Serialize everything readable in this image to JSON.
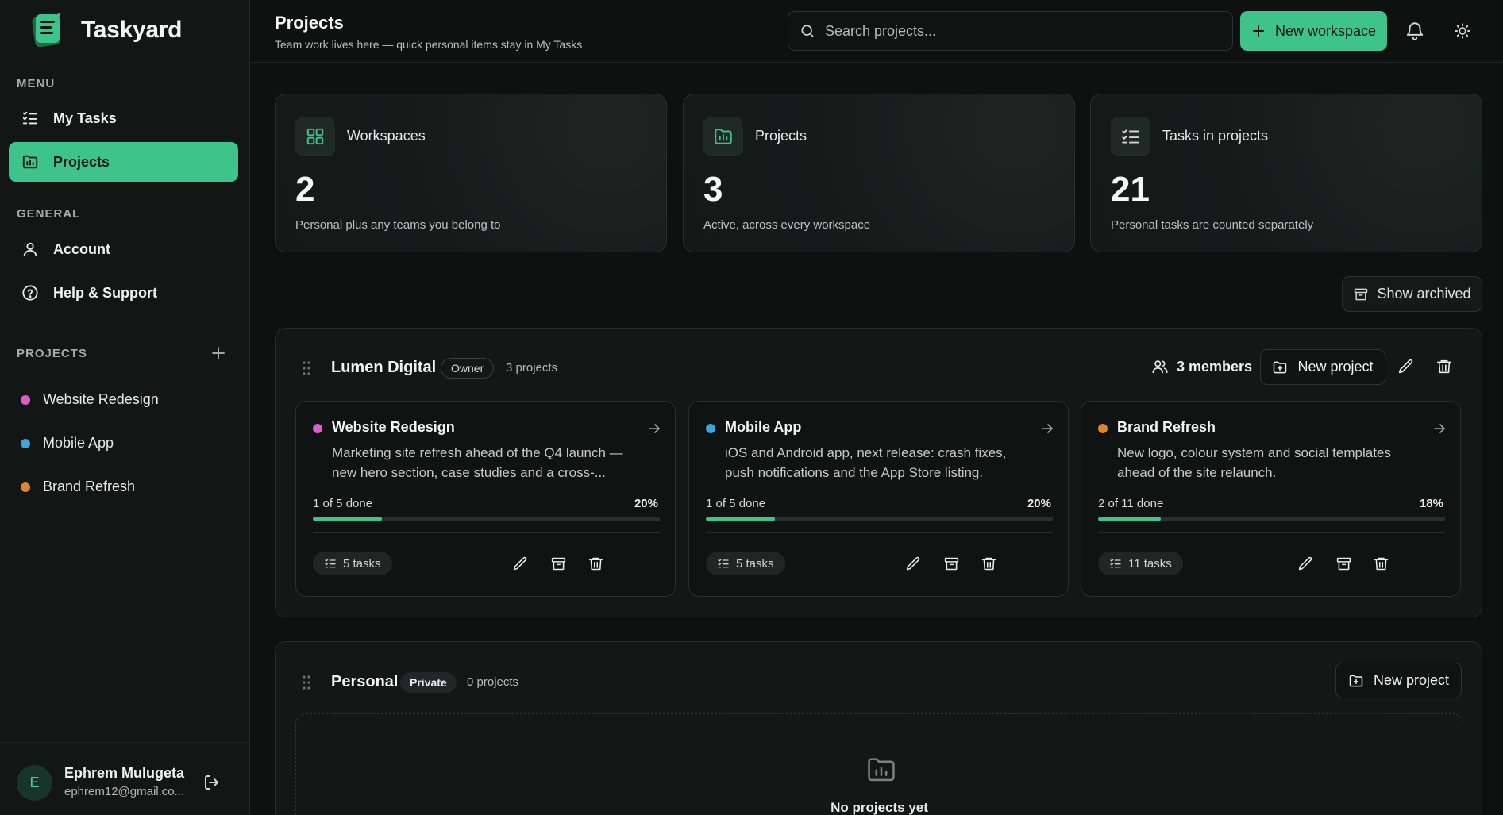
{
  "brand": {
    "name": "Taskyard"
  },
  "sidebar": {
    "menu_label": "MENU",
    "menu_items": [
      {
        "label": "My Tasks",
        "icon": "list-checks-icon"
      },
      {
        "label": "Projects",
        "icon": "folder-chart-icon",
        "active": true
      }
    ],
    "general_label": "GENERAL",
    "general_items": [
      {
        "label": "Account",
        "icon": "user-icon"
      },
      {
        "label": "Help & Support",
        "icon": "help-circle-icon"
      }
    ],
    "projects_label": "PROJECTS",
    "projects": [
      {
        "name": "Website Redesign",
        "color": "#d85fd0"
      },
      {
        "name": "Mobile App",
        "color": "#3aa6db"
      },
      {
        "name": "Brand Refresh",
        "color": "#e2832e"
      }
    ]
  },
  "user": {
    "initial": "E",
    "name": "Ephrem Mulugeta",
    "email": "ephrem12@gmail.co..."
  },
  "header": {
    "title": "Projects",
    "subtitle": "Team work lives here — quick personal items stay in My Tasks",
    "search_placeholder": "Search projects...",
    "new_workspace_label": "New workspace"
  },
  "stats": [
    {
      "label": "Workspaces",
      "value": "2",
      "desc": "Personal plus any teams you belong to",
      "icon": "grid-icon"
    },
    {
      "label": "Projects",
      "value": "3",
      "desc": "Active, across every workspace",
      "icon": "folder-chart-icon"
    },
    {
      "label": "Tasks in projects",
      "value": "21",
      "desc": "Personal tasks are counted separately",
      "icon": "list-checks-icon"
    }
  ],
  "show_archived_label": "Show archived",
  "workspaces": [
    {
      "name": "Lumen Digital",
      "role": "Owner",
      "count": "3 projects",
      "members": "3 members",
      "new_project_label": "New project",
      "projects": [
        {
          "title": "Website Redesign",
          "color": "#d85fd0",
          "desc": "Marketing site refresh ahead of the Q4 launch — new hero section, case studies and a cross-...",
          "progress_label": "1 of 5 done",
          "percent": "20%",
          "fraction": 0.2,
          "tasks": "5 tasks"
        },
        {
          "title": "Mobile App",
          "color": "#3aa6db",
          "desc": "iOS and Android app, next release: crash fixes, push notifications and the App Store listing.",
          "progress_label": "1 of 5 done",
          "percent": "20%",
          "fraction": 0.2,
          "tasks": "5 tasks"
        },
        {
          "title": "Brand Refresh",
          "color": "#e2832e",
          "desc": "New logo, colour system and social templates ahead of the site relaunch.",
          "progress_label": "2 of 11 done",
          "percent": "18%",
          "fraction": 0.18,
          "tasks": "11 tasks"
        }
      ]
    },
    {
      "name": "Personal",
      "role": "Private",
      "count": "0 projects",
      "new_project_label": "New project",
      "empty_text": "No projects yet"
    }
  ],
  "colors": {
    "accent": "#3ec48b"
  }
}
